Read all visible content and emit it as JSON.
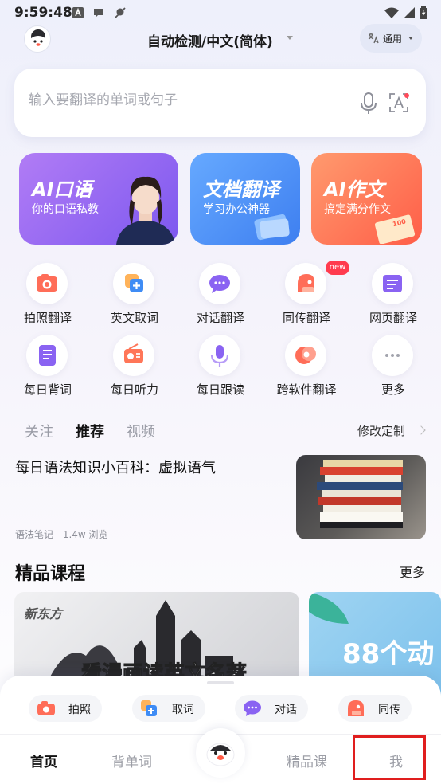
{
  "status_bar": {
    "time": "9:59:48"
  },
  "header": {
    "language": "自动检测/中文(简体)",
    "mode": "通用"
  },
  "search": {
    "placeholder": "输入要翻译的单词或句子"
  },
  "cards": [
    {
      "title": "AI口语",
      "subtitle": "你的口语私教"
    },
    {
      "title": "文档翻译",
      "subtitle": "学习办公神器"
    },
    {
      "title": "AI作文",
      "subtitle": "搞定满分作文"
    }
  ],
  "grid": [
    {
      "label": "拍照翻译",
      "icon": "camera-icon"
    },
    {
      "label": "英文取词",
      "icon": "add-word-icon"
    },
    {
      "label": "对话翻译",
      "icon": "chat-icon"
    },
    {
      "label": "同传翻译",
      "icon": "interpret-icon"
    },
    {
      "label": "网页翻译",
      "icon": "webpage-icon"
    },
    {
      "label": "每日背词",
      "icon": "word-list-icon"
    },
    {
      "label": "每日听力",
      "icon": "radio-icon"
    },
    {
      "label": "每日跟读",
      "icon": "mic-icon"
    },
    {
      "label": "跨软件翻译",
      "icon": "cross-app-icon"
    },
    {
      "label": "更多",
      "icon": "more-icon"
    }
  ],
  "new_badge": "new",
  "feed_tabs": [
    "关注",
    "推荐",
    "视频"
  ],
  "customize_label": "修改定制",
  "article": {
    "title": "每日语法知识小百科：虚拟语气",
    "source": "语法笔记",
    "views": "1.4w 浏览"
  },
  "courses": {
    "title": "精品课程",
    "more": "更多",
    "card1_brand": "新东方",
    "card1_text": "看漫画读英文名著",
    "card2_text": "88个动"
  },
  "quick_actions": [
    {
      "label": "拍照",
      "icon": "camera-icon"
    },
    {
      "label": "取词",
      "icon": "add-word-icon"
    },
    {
      "label": "对话",
      "icon": "chat-icon"
    },
    {
      "label": "同传",
      "icon": "interpret-icon"
    }
  ],
  "bottom_nav": [
    "首页",
    "背单词",
    "精品课",
    "我"
  ],
  "colors": {
    "accent_red": "#ff5a45",
    "highlight": "#e01e1e",
    "card_purple": "#8a63f2",
    "card_blue": "#4c8ff5",
    "card_orange": "#ff7658"
  }
}
